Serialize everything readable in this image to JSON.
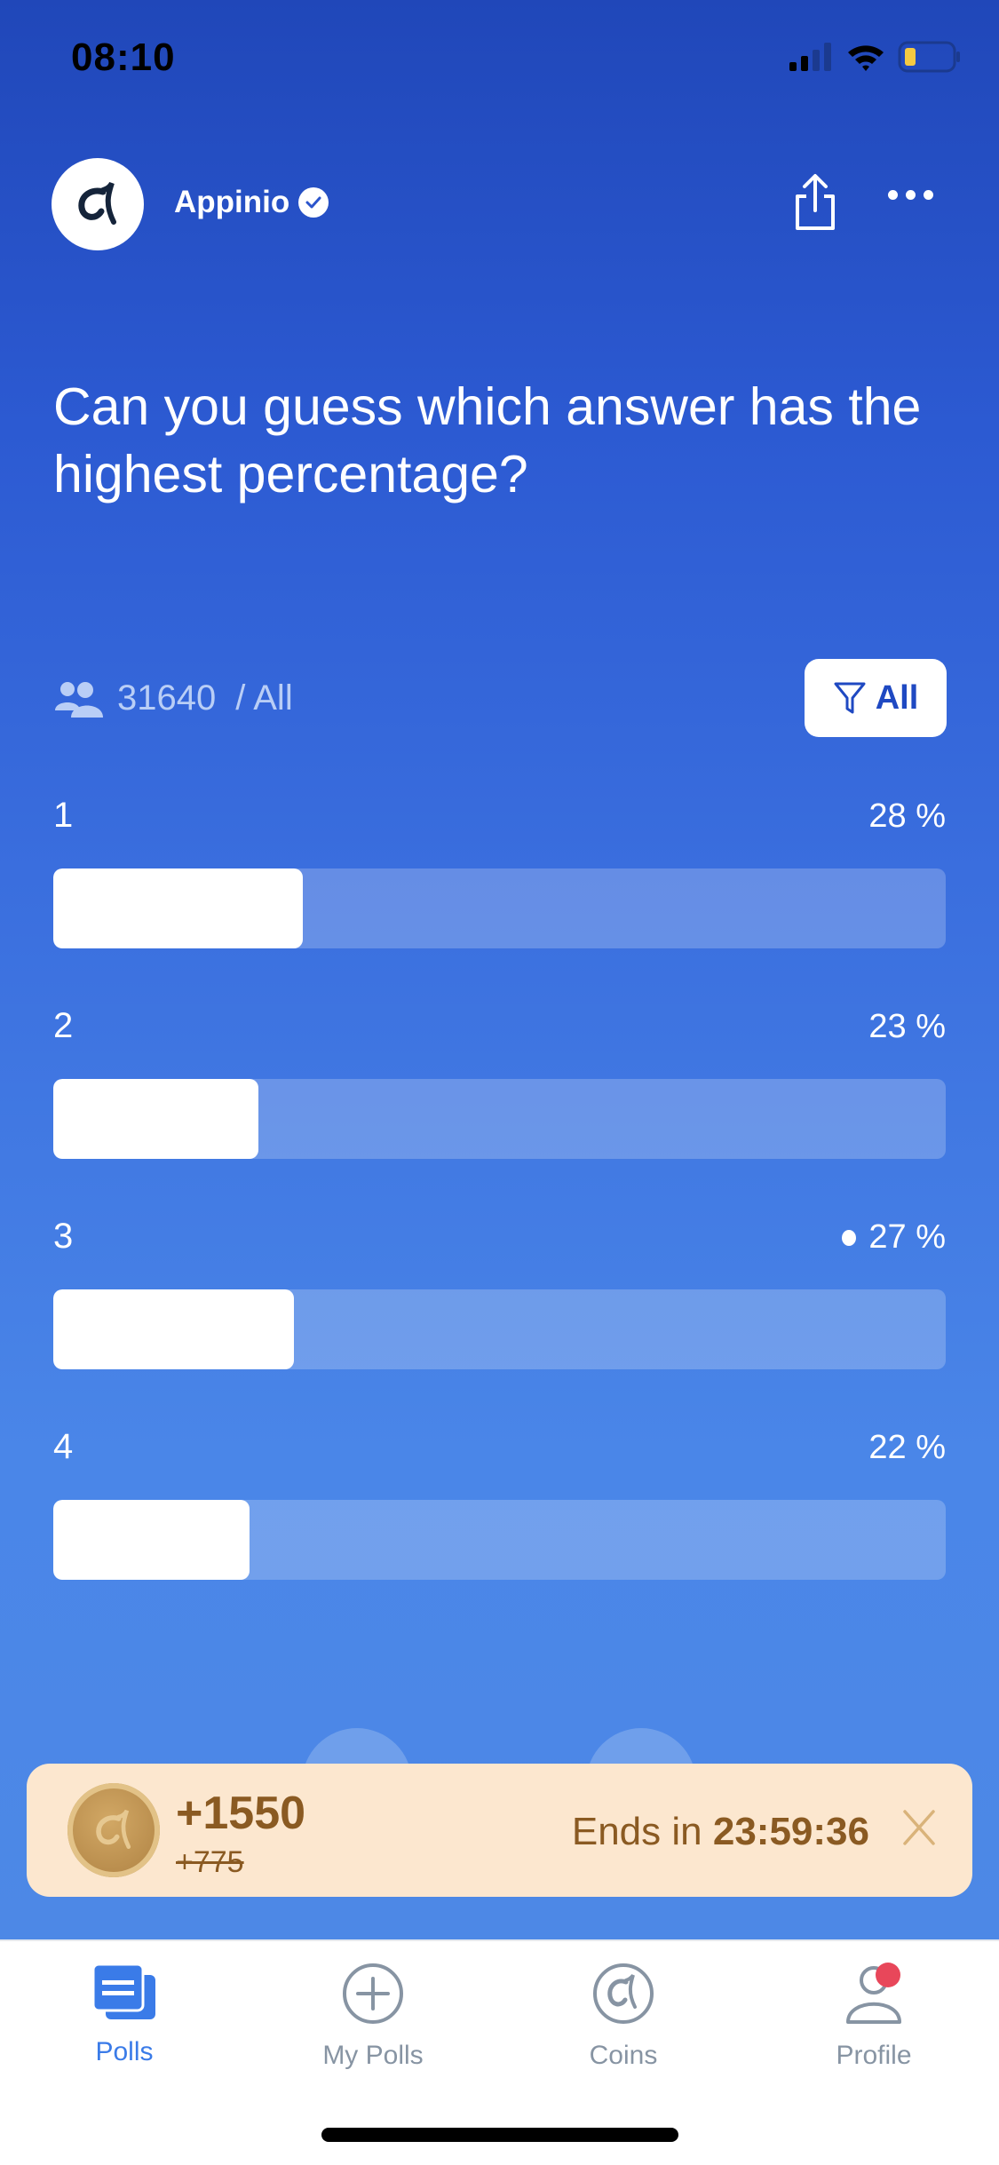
{
  "status_bar": {
    "time": "08:10",
    "icons": [
      "cellular-signal-icon",
      "wifi-icon",
      "battery-low-icon"
    ]
  },
  "header": {
    "brand_name": "Appinio",
    "verified_icon": "verified-check-icon",
    "share_icon": "share-icon",
    "more_icon": "more-dots-icon"
  },
  "poll": {
    "question": "Can you guess which answer has the highest percentage?",
    "participants": "31640",
    "audience": "/ All",
    "filter_label": "All",
    "answers": [
      {
        "label": "1",
        "percent_text": "28 %",
        "value": 28,
        "selected": false
      },
      {
        "label": "2",
        "percent_text": "23 %",
        "value": 23,
        "selected": false
      },
      {
        "label": "3",
        "percent_text": "27 %",
        "value": 27,
        "selected": true
      },
      {
        "label": "4",
        "percent_text": "22 %",
        "value": 22,
        "selected": false
      }
    ]
  },
  "banner": {
    "bonus": "+1550",
    "old_bonus": "+775",
    "ends_prefix": "Ends in",
    "countdown": "23:59:36"
  },
  "tabbar": {
    "items": [
      {
        "label": "Polls",
        "icon": "polls-icon",
        "active": true
      },
      {
        "label": "My Polls",
        "icon": "add-circle-icon",
        "active": false
      },
      {
        "label": "Coins",
        "icon": "coins-icon",
        "active": false
      },
      {
        "label": "Profile",
        "icon": "profile-icon",
        "active": false,
        "badge": true
      }
    ]
  },
  "colors": {
    "accent": "#3A7BE8",
    "banner_bg": "#FCE7CF",
    "banner_text": "#8A5A22",
    "badge": "#E8475A"
  }
}
